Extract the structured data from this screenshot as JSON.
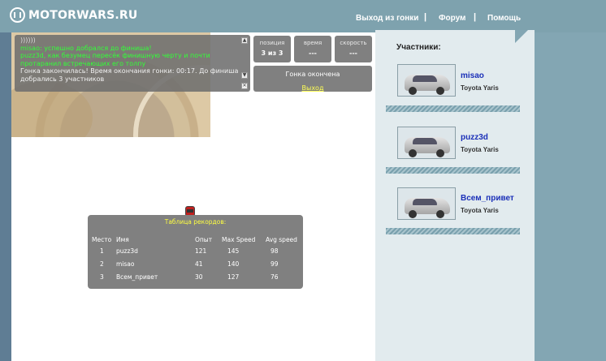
{
  "header": {
    "logo_text": "MOTORWARS.RU",
    "nav": [
      "Выход из гонки",
      "Форум",
      "Помощь"
    ],
    "separator": "|"
  },
  "chat": {
    "lines": [
      {
        "text": "))))))",
        "color": "gray"
      },
      {
        "text": "misao: успешно добрался до финиша!",
        "color": "green"
      },
      {
        "text": "puzz3d, как безумец пересёк финишную черту и почти",
        "color": "green"
      },
      {
        "text": "протаранил встречающих его толпу",
        "color": "green"
      },
      {
        "text": "Гонка закончилась! Время окончания гонки: 00:17. До финиша",
        "color": "white"
      },
      {
        "text": "добрались 3 участников",
        "color": "white"
      }
    ]
  },
  "stats": {
    "position": {
      "label": "позиция",
      "value": "3 из 3"
    },
    "time": {
      "label": "время",
      "value": "---"
    },
    "speed": {
      "label": "скорость",
      "value": "---"
    }
  },
  "race_status": {
    "text": "Гонка окончена",
    "link": "Выход"
  },
  "records": {
    "title": "Таблица рекордов:",
    "headers": [
      "Место",
      "Имя",
      "Опыт",
      "Max Speed",
      "Avg speed"
    ],
    "rows": [
      [
        "1",
        "puzz3d",
        "121",
        "145",
        "98"
      ],
      [
        "2",
        "misao",
        "41",
        "140",
        "99"
      ],
      [
        "3",
        "Всем_привет",
        "30",
        "127",
        "76"
      ]
    ]
  },
  "participants": {
    "title": "Участники:",
    "list": [
      {
        "name": "misao",
        "car": "Toyota Yaris"
      },
      {
        "name": "puzz3d",
        "car": "Toyota Yaris"
      },
      {
        "name": "Всем_привет",
        "car": "Toyota Yaris"
      }
    ]
  },
  "colors": {
    "header_bg": "#7ea2ae",
    "chat_green": "#32ff38",
    "link_yellow": "#ffff55",
    "participant_name": "#1a2fb8"
  }
}
